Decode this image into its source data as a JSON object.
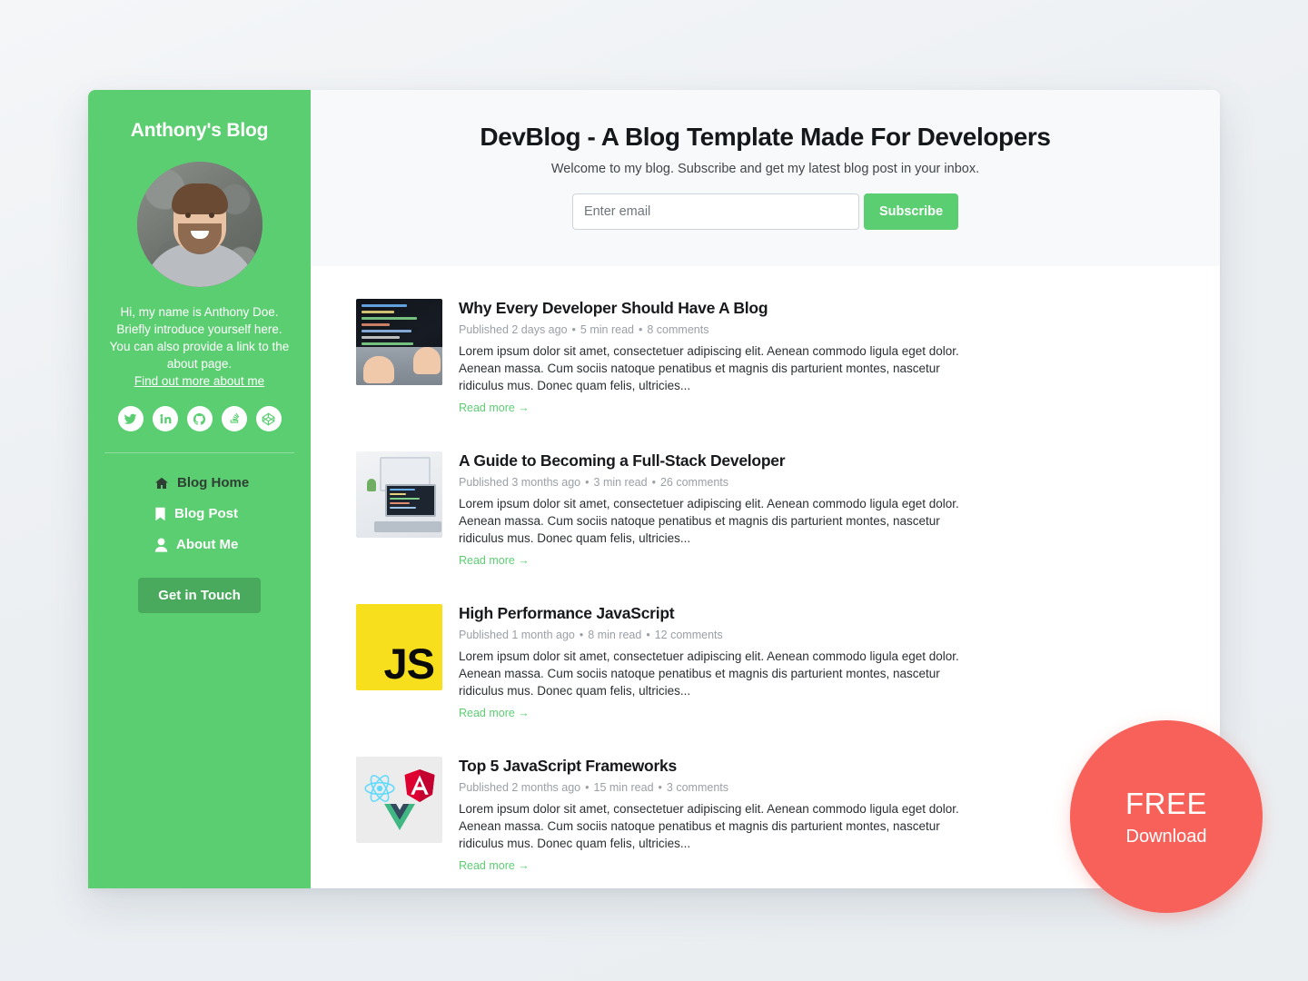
{
  "sidebar": {
    "blog_title": "Anthony's Blog",
    "avatar_alt": "avatar",
    "bio": "Hi, my name is Anthony Doe. Briefly introduce yourself here. You can also provide a link to the about page.",
    "bio_link": "Find out more about me",
    "socials": [
      {
        "name": "twitter-icon",
        "label": "Twitter"
      },
      {
        "name": "linkedin-icon",
        "label": "LinkedIn"
      },
      {
        "name": "github-icon",
        "label": "GitHub"
      },
      {
        "name": "stackoverflow-icon",
        "label": "Stack Overflow"
      },
      {
        "name": "codepen-icon",
        "label": "CodePen"
      }
    ],
    "nav": [
      {
        "label": "Blog Home",
        "icon": "home-icon",
        "active": true
      },
      {
        "label": "Blog Post",
        "icon": "bookmark-icon",
        "active": false
      },
      {
        "label": "About Me",
        "icon": "user-icon",
        "active": false
      }
    ],
    "cta_label": "Get in Touch",
    "accent": "#5CCE72",
    "cta_color": "#49A95C"
  },
  "showcase": {
    "title": "DevBlog - A Blog Template Made For Developers",
    "subtitle": "Welcome to my blog. Subscribe and get my latest blog post in your inbox.",
    "email_value": "",
    "email_placeholder": "Enter email",
    "subscribe_label": "Subscribe"
  },
  "posts": [
    {
      "title": "Why Every Developer Should Have A Blog",
      "published": "Published 2 days ago",
      "read_time": "5 min read",
      "comments": "8 comments",
      "excerpt": "Lorem ipsum dolor sit amet, consectetuer adipiscing elit. Aenean commodo ligula eget dolor. Aenean massa. Cum sociis natoque penatibus et magnis dis parturient montes, nascetur ridiculus mus. Donec quam felis, ultricies...",
      "read_more": "Read more →",
      "thumb": "laptop-code-photo"
    },
    {
      "title": "A Guide to Becoming a Full-Stack Developer",
      "published": "Published 3 months ago",
      "read_time": "3 min read",
      "comments": "26 comments",
      "excerpt": "Lorem ipsum dolor sit amet, consectetuer adipiscing elit. Aenean commodo ligula eget dolor. Aenean massa. Cum sociis natoque penatibus et magnis dis parturient montes, nascetur ridiculus mus. Donec quam felis, ultricies...",
      "read_more": "Read more →",
      "thumb": "desk-workspace-photo"
    },
    {
      "title": "High Performance JavaScript",
      "published": "Published 1 month ago",
      "read_time": "8 min read",
      "comments": "12 comments",
      "excerpt": "Lorem ipsum dolor sit amet, consectetuer adipiscing elit. Aenean commodo ligula eget dolor. Aenean massa. Cum sociis natoque penatibus et magnis dis parturient montes, nascetur ridiculus mus. Donec quam felis, ultricies...",
      "read_more": "Read more →",
      "thumb": "javascript-logo",
      "thumb_text": "JS"
    },
    {
      "title": "Top 5 JavaScript Frameworks",
      "published": "Published 2 months ago",
      "read_time": "15 min read",
      "comments": "3 comments",
      "excerpt": "Lorem ipsum dolor sit amet, consectetuer adipiscing elit. Aenean commodo ligula eget dolor. Aenean massa. Cum sociis natoque penatibus et magnis dis parturient montes, nascetur ridiculus mus. Donec quam felis, ultricies...",
      "read_more": "Read more →",
      "thumb": "frameworks-logos"
    }
  ],
  "free_badge": {
    "main": "FREE",
    "sub": "Download",
    "color": "#F8615A"
  }
}
